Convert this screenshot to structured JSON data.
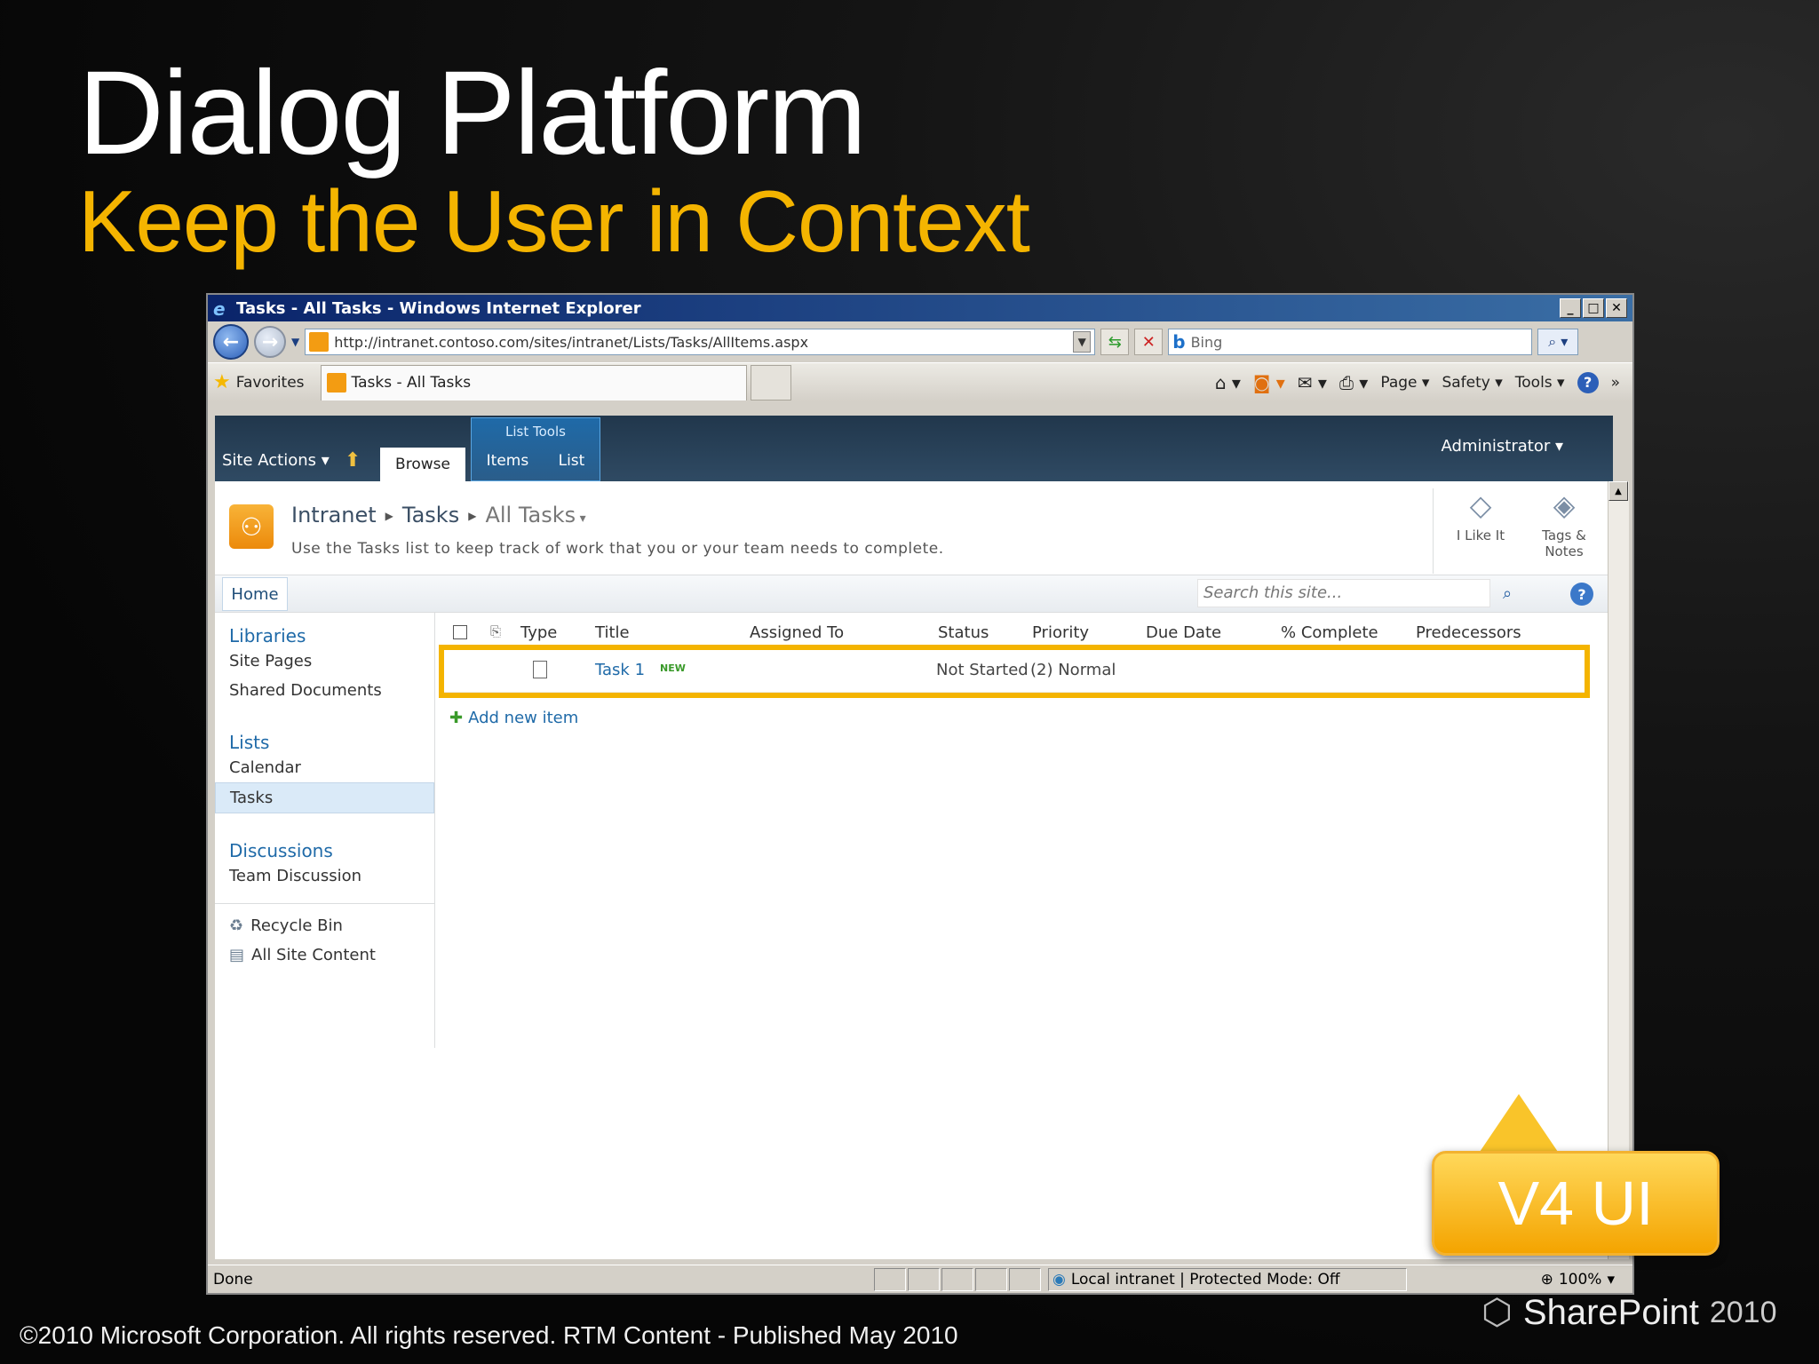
{
  "slide": {
    "title": "Dialog Platform",
    "subtitle": "Keep the User in Context",
    "copyright": "©2010 Microsoft Corporation. All rights reserved. RTM Content - Published May 2010",
    "logo_brand": "SharePoint",
    "logo_year": "2010",
    "callout": "V4 UI"
  },
  "browser": {
    "window_title": "Tasks - All Tasks - Windows Internet Explorer",
    "url": "http://intranet.contoso.com/sites/intranet/Lists/Tasks/AllItems.aspx",
    "search_placeholder": "Bing",
    "favorites_label": "Favorites",
    "tab_label": "Tasks - All Tasks",
    "cmd": {
      "page": "Page ▾",
      "safety": "Safety ▾",
      "tools": "Tools ▾"
    },
    "status_done": "Done",
    "zone_text": "Local intranet | Protected Mode: Off",
    "zoom": "100%"
  },
  "ribbon": {
    "site_actions": "Site Actions ▾",
    "browse_tab": "Browse",
    "context_group": "List Tools",
    "tab_items": "Items",
    "tab_list": "List",
    "user": "Administrator ▾"
  },
  "title_area": {
    "crumbs": [
      "Intranet",
      "Tasks",
      "All Tasks"
    ],
    "description": "Use the Tasks list to keep track of work that you or your team needs to complete.",
    "i_like_it": "I Like It",
    "tags_notes": "Tags & Notes"
  },
  "topnav": {
    "home": "Home",
    "search_placeholder": "Search this site..."
  },
  "quicklaunch": {
    "libraries": "Libraries",
    "library_items": [
      "Site Pages",
      "Shared Documents"
    ],
    "lists": "Lists",
    "list_items": [
      "Calendar",
      "Tasks"
    ],
    "discussions": "Discussions",
    "discussion_items": [
      "Team Discussion"
    ],
    "recycle_bin": "Recycle Bin",
    "all_site_content": "All Site Content"
  },
  "list": {
    "columns": [
      "Type",
      "Title",
      "Assigned To",
      "Status",
      "Priority",
      "Due Date",
      "% Complete",
      "Predecessors"
    ],
    "rows": [
      {
        "title": "Task 1",
        "new_badge": "NEW",
        "status": "Not Started",
        "priority": "(2) Normal"
      }
    ],
    "add_new": "Add new item"
  },
  "colors": {
    "accent": "#f4b400",
    "ribbon": "#2f4a63",
    "link": "#1f6aa8"
  }
}
